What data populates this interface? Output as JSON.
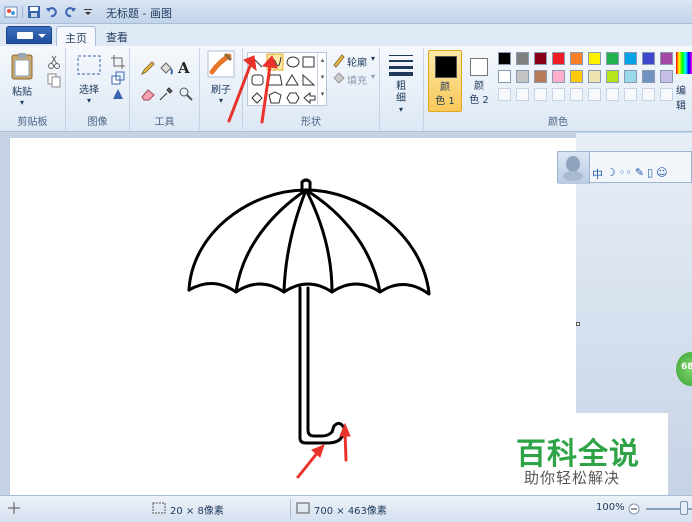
{
  "window": {
    "title": "无标题 - 画图"
  },
  "tabs": [
    {
      "label": "主页"
    },
    {
      "label": "查看"
    }
  ],
  "ribbon": {
    "clipboard": {
      "group_label": "剪贴板",
      "paste_label": "粘贴"
    },
    "image": {
      "group_label": "图像",
      "select_label": "选择"
    },
    "tools": {
      "group_label": "工具"
    },
    "brushes": {
      "label": "刷子"
    },
    "shapes": {
      "group_label": "形状",
      "outline_label": "轮廓",
      "fill_label": "填充"
    },
    "size": {
      "label": "粗\n细"
    },
    "colors": {
      "group_label": "颜色",
      "color1_label": "颜\n色 1",
      "color2_label": "颜\n色 2",
      "edit_label": "编辑",
      "color1_value": "#000000",
      "color2_value": "#ffffff",
      "palette_row1": [
        "#000000",
        "#7f7f7f",
        "#880015",
        "#ed1c24",
        "#ff7f27",
        "#fff200",
        "#22b14c",
        "#00a2e8",
        "#3f48cc",
        "#a349a4"
      ],
      "palette_row2": [
        "#ffffff",
        "#c3c3c3",
        "#b97a57",
        "#ffaec9",
        "#ffc90e",
        "#efe4b0",
        "#b5e61d",
        "#99d9ea",
        "#7092be",
        "#c8bfe7"
      ]
    }
  },
  "qq_toolbar": {
    "items": [
      "中",
      "☽",
      "◦◦",
      "✎",
      "▯",
      "☺"
    ]
  },
  "side_badge": {
    "text": "68"
  },
  "watermark": {
    "title": "百科全说",
    "subtitle": "助你轻松解决"
  },
  "statusbar": {
    "selection_size": "20 × 8像素",
    "canvas_size": "700 × 463像素",
    "zoom": "100%"
  },
  "annotation_color": "#e8322a"
}
